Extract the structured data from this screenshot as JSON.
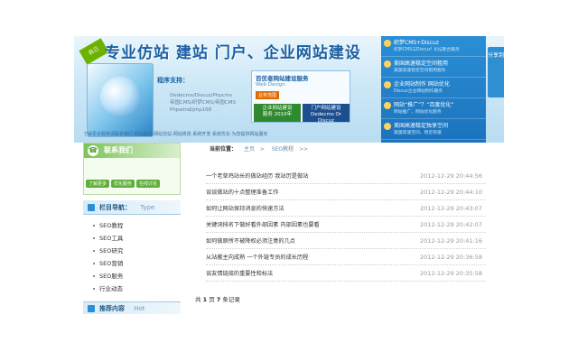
{
  "banner": {
    "title": "专业仿站  建站  门户、企业网站建设",
    "ribbon": "自己",
    "support_label": "程序支持：",
    "support_text": "Dedecms/Discuz/Phpcms 帝国CMS/织梦CMS/帝国CMS Phpwind/php168",
    "contact_strip": "了解更多服务请联系我们·网站建设·网站仿站·网站修改·系统开发·系统优化·为您提供网站服务"
  },
  "service": {
    "title": "百优者网站建设服务",
    "subtitle": "Web Design",
    "tag": "业务范围",
    "btn_a_line1": "企业网站建设",
    "btn_a_line2": "服务 2010年",
    "btn_b_line1": "门户网站建设",
    "btn_b_line2": "Dedecms Or Discuz"
  },
  "news": [
    {
      "title": "织梦CMS+Discuz",
      "sub": "织梦CMS与Discuz! 论坛整合服务"
    },
    {
      "title": "美国高速稳定空间租用",
      "sub": "美国高速稳定空间租用服务"
    },
    {
      "title": "企业网站制作  网站优化",
      "sub": "Discuz企业网站制作服务"
    },
    {
      "title": "网站“推广”？“百度优化”",
      "sub": "网站推广、网站优化服务"
    },
    {
      "title": "美国高速稳定独享空间",
      "sub": "美国高速空间，稳定快速"
    }
  ],
  "share_label": "分享到",
  "sidebar": {
    "contact_title": "联系我们",
    "contact_buttons": [
      "了解更多",
      "优化服务",
      "在线讨论"
    ],
    "nav_title": "栏目导航：",
    "nav_title_en": "Type",
    "nav_items": [
      "SEO教程",
      "SEO工具",
      "SEO研究",
      "SEO营销",
      "SEO服务",
      "行业动态"
    ],
    "rec_title": "推荐内容",
    "rec_title_en": "Hot"
  },
  "breadcrumb": {
    "label": "当前位置：",
    "home": "主页",
    "sep": ">",
    "category": "SEO教程",
    "arrow": ">>"
  },
  "articles": [
    {
      "title": "一个老草鸡站长的做站经历 我站历是做站",
      "date": "2012-12-29 20:44:56"
    },
    {
      "title": "谈谈做站的十点整理准备工作",
      "date": "2012-12-29 20:44:10"
    },
    {
      "title": "如何让网站保持消息的快速方法",
      "date": "2012-12-29 20:43:07"
    },
    {
      "title": "关键词排名下做好看外部因素 内部因素也要看",
      "date": "2012-12-29 20:42:07"
    },
    {
      "title": "如何做原所不被降权必须注意的几点",
      "date": "2012-12-29 20:41:16"
    },
    {
      "title": "从站搬主向成熟 一个外链专员的成长历程",
      "date": "2012-12-29 20:36:58"
    },
    {
      "title": "谈友情链接的重要性和标法",
      "date": "2012-12-29 20:35:58"
    }
  ],
  "pager": {
    "prefix": "共",
    "pages": "1",
    "mid": "页",
    "count": "7",
    "suffix": "条记录"
  }
}
